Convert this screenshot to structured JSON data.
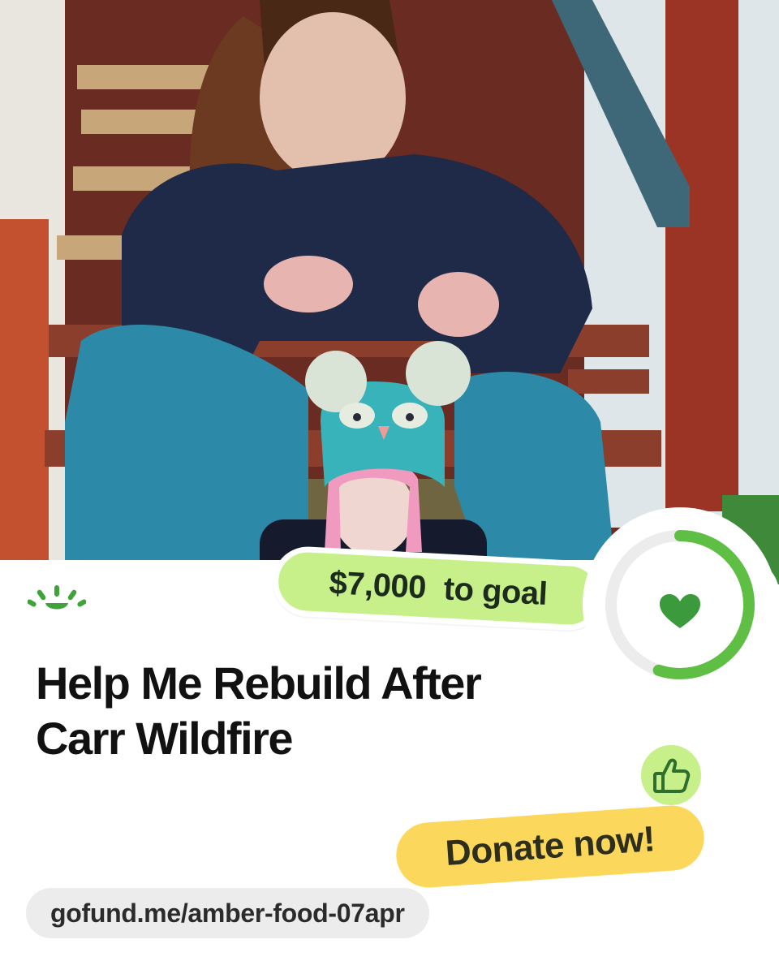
{
  "goal": {
    "amount": "$7,000",
    "text": "to goal"
  },
  "campaign": {
    "title": "Help Me Rebuild After Carr Wildfire"
  },
  "actions": {
    "donate_label": "Donate now!"
  },
  "link": {
    "url": "gofund.me/amber-food-07apr"
  },
  "icons": {
    "logo": "gofundme-sprout-icon",
    "heart": "heart-icon",
    "thumb": "thumbs-up-icon"
  },
  "colors": {
    "brand_green": "#3fa33a",
    "goal_pill": "#c7f08a",
    "donate_pill": "#fbd85c",
    "url_pill": "#ececec"
  },
  "progress": {
    "fraction": 0.55
  }
}
